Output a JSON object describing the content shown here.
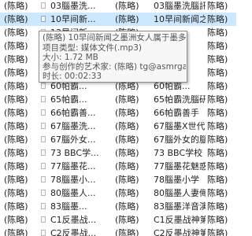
{
  "rows": [
    {
      "artist1": "(陈略)",
      "title1": "03腦墨洗...",
      "artist2": "(陈略)",
      "title2": "03腦墨洗腦訊训...",
      "artist3": "陈略)",
      "selected": false
    },
    {
      "artist1": "(陈略)",
      "title1": "10早间新...",
      "artist2": "(陈略)",
      "title2": "10早间新闻之...",
      "artist3": "陈略)",
      "selected": true
    },
    {
      "artist1": "(陈略)",
      "title1": "13早间新...",
      "artist2": "(陈略)",
      "title2": "",
      "artist3": "陈略)",
      "selected": false
    },
    {
      "artist1": "(陈略)",
      "title1": "15海外...",
      "artist2": "(陈略)",
      "title2": "",
      "artist3": "陈略)",
      "selected": false
    },
    {
      "artist1": "(陈略)",
      "title1": "37人工智...",
      "artist2": "(陈略)",
      "title2": "",
      "artist3": "陈略)",
      "selected": false
    },
    {
      "artist1": "(陈略)",
      "title1": "53我大概...",
      "artist2": "(陈略)",
      "title2": "",
      "artist3": "陈略)",
      "selected": false
    },
    {
      "artist1": "(陈略)",
      "title1": "60帕霸...",
      "artist2": "(陈略)",
      "title2": "60帕霸...",
      "artist3": "陈略)",
      "selected": false
    },
    {
      "artist1": "(陈略)",
      "title1": "65帕霸...",
      "artist2": "(陈略)",
      "title2": "65帕霸洗腦研究",
      "artist3": "陈略)",
      "selected": false
    },
    {
      "artist1": "(陈略)",
      "title1": "66帕霸善...",
      "artist2": "(陈略)",
      "title2": "66帕霸善手",
      "artist3": "陈略)",
      "selected": false
    },
    {
      "artist1": "(陈略)",
      "title1": "67腦墨洗...",
      "artist2": "(陈略)",
      "title2": "67腦墨X世代的...",
      "artist3": "陈略)",
      "selected": false
    },
    {
      "artist1": "(陈略)",
      "title1": "67腦外女...",
      "artist2": "(陈略)",
      "title2": "67腦外女的腦補...",
      "artist3": "陈略)",
      "selected": false
    },
    {
      "artist1": "(陈略)",
      "title1": "73 BBC学...",
      "artist2": "(陈略)",
      "title2": "73 BBC学校",
      "artist3": "陈略)",
      "selected": false
    },
    {
      "artist1": "(陈略)",
      "title1": "77腦墨花...",
      "artist2": "(陈略)",
      "title2": "77腦墨花魅惑",
      "artist3": "陈略)",
      "selected": false
    },
    {
      "artist1": "(陈略)",
      "title1": "78腦墨小...",
      "artist2": "(陈略)",
      "title2": "78腦墨小学",
      "artist3": "陈略)",
      "selected": false
    },
    {
      "artist1": "(陈略)",
      "title1": "80腦墨人...",
      "artist2": "(陈略)",
      "title2": "80腦墨人妻侮辱...",
      "artist3": "陈略)",
      "selected": false
    },
    {
      "artist1": "(陈略)",
      "title1": "83腦墨...",
      "artist2": "(陈略)",
      "title2": "83腦墨洋音演讲",
      "artist3": "陈略)",
      "selected": false
    },
    {
      "artist1": "(陈略)",
      "title1": "C1反墨战...",
      "artist2": "(陈略)",
      "title2": "C1反墨战神第一...",
      "artist3": "陈略)",
      "selected": false
    },
    {
      "artist1": "(陈略)",
      "title1": "C2反墨战...",
      "artist2": "(陈略)",
      "title2": "C2反墨战神第二...",
      "artist3": "陈略)",
      "selected": false
    }
  ],
  "tooltip": {
    "title": "(陈略) 10早间新闻之墨洲女人属于墨多.mp3",
    "type": "项目类型: 媒体文件(.mp3)",
    "size": "大小: 1.72 MB",
    "contributing_artists": "参与创作的艺术家: (陈略) tg@asmrgay",
    "length": "时长: 00:02:33"
  },
  "colors": {
    "selection": "#cce8ff",
    "tooltip_bg": "#f7f7f7",
    "tooltip_border": "#8d8d8d"
  }
}
